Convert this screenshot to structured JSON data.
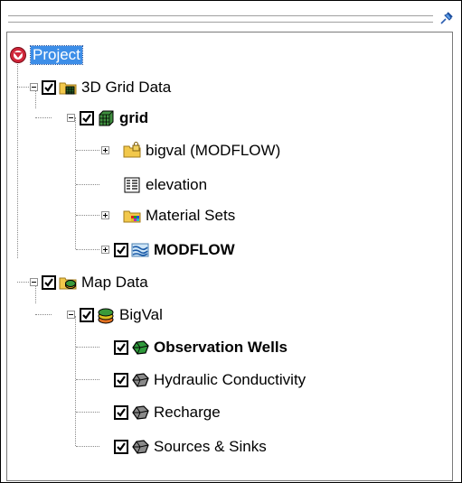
{
  "tree": {
    "root": {
      "label": "Project",
      "icon": "project-icon"
    },
    "items": [
      {
        "label": "3D Grid Data",
        "icon": "3d-grid-folder-icon",
        "checked": true,
        "expanded": true
      },
      {
        "label": "grid",
        "icon": "grid-icon",
        "checked": true,
        "expanded": true,
        "bold": true
      },
      {
        "label": "bigval (MODFLOW)",
        "icon": "locked-folder-icon",
        "expanded": false
      },
      {
        "label": "elevation",
        "icon": "dataset-icon"
      },
      {
        "label": "Material Sets",
        "icon": "material-folder-icon",
        "expanded": false
      },
      {
        "label": "MODFLOW",
        "icon": "modflow-icon",
        "checked": true,
        "expanded": false,
        "bold": true
      },
      {
        "label": "Map Data",
        "icon": "map-folder-icon",
        "checked": true,
        "expanded": true
      },
      {
        "label": "BigVal",
        "icon": "conceptual-model-icon",
        "checked": true,
        "expanded": true
      },
      {
        "label": "Observation Wells",
        "icon": "coverage-green-icon",
        "checked": true,
        "bold": true
      },
      {
        "label": "Hydraulic Conductivity",
        "icon": "coverage-gray-icon",
        "checked": true
      },
      {
        "label": "Recharge",
        "icon": "coverage-gray-icon",
        "checked": true
      },
      {
        "label": "Sources & Sinks",
        "icon": "coverage-gray-icon",
        "checked": true
      }
    ]
  },
  "colors": {
    "selection": "#3d8ee8",
    "root_icon": "#d0263a",
    "folder": "#f2c84b",
    "coverage_green": "#2f9a3c",
    "coverage_gray": "#8a8a8a"
  }
}
